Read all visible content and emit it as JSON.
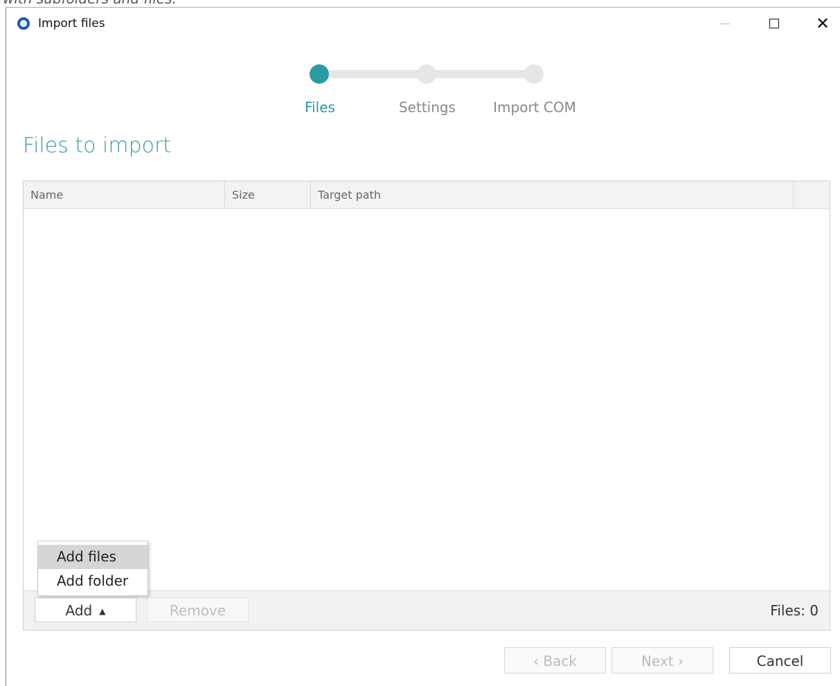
{
  "background_caption": "with subfolders and files.",
  "window": {
    "title": "Import files",
    "controls": {
      "minimize": "—",
      "maximize": "☐",
      "close": "✕"
    }
  },
  "stepper": {
    "steps": [
      {
        "label": "Files",
        "state": "active"
      },
      {
        "label": "Settings",
        "state": "inactive"
      },
      {
        "label": "Import COM",
        "state": "inactive"
      }
    ],
    "active_color": "#2a9ba3"
  },
  "section": {
    "title": "Files to import"
  },
  "table": {
    "columns": [
      "Name",
      "Size",
      "Target path",
      ""
    ],
    "rows": []
  },
  "footer": {
    "add_label": "Add",
    "add_caret": "▲",
    "remove_label": "Remove",
    "files_count": "Files: 0"
  },
  "add_menu": {
    "items": [
      "Add files",
      "Add folder"
    ],
    "highlighted": "Add files"
  },
  "dialog_buttons": {
    "back": "‹ Back",
    "next": "Next ›",
    "cancel": "Cancel"
  }
}
